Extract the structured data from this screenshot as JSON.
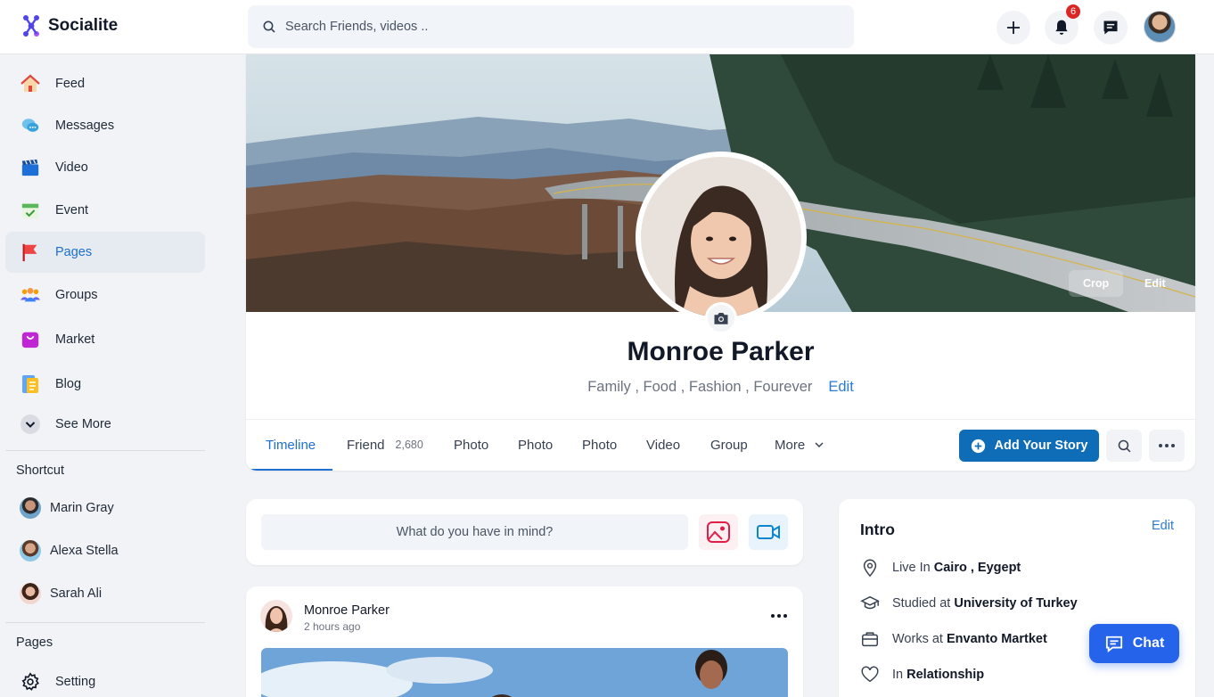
{
  "app": {
    "name": "Socialite"
  },
  "search": {
    "placeholder": "Search Friends, videos .."
  },
  "header": {
    "notification_count": "6"
  },
  "sidebar": {
    "items": [
      {
        "label": "Feed",
        "icon": "home-icon"
      },
      {
        "label": "Messages",
        "icon": "messages-icon"
      },
      {
        "label": "Video",
        "icon": "video-icon"
      },
      {
        "label": "Event",
        "icon": "event-icon"
      },
      {
        "label": "Pages",
        "icon": "flag-icon"
      },
      {
        "label": "Groups",
        "icon": "groups-icon"
      },
      {
        "label": "Market",
        "icon": "shopping-bag-icon"
      },
      {
        "label": "Blog",
        "icon": "blog-icon"
      },
      {
        "label": "See More",
        "icon": "chevron-down-icon"
      }
    ],
    "shortcut_title": "Shortcut",
    "shortcuts": [
      {
        "name": "Marin Gray"
      },
      {
        "name": "Alexa Stella"
      },
      {
        "name": "Sarah Ali"
      }
    ],
    "pages_title": "Pages",
    "setting_label": "Setting"
  },
  "profile": {
    "name": "Monroe Parker",
    "tags": "Family , Food , Fashion , Fourever",
    "edit_label": "Edit",
    "crop_label": "Crop",
    "cover_edit_label": "Edit",
    "tabs": [
      {
        "label": "Timeline"
      },
      {
        "label": "Friend",
        "count": "2,680"
      },
      {
        "label": "Photo"
      },
      {
        "label": "Photo"
      },
      {
        "label": "Photo"
      },
      {
        "label": "Video"
      },
      {
        "label": "Group"
      },
      {
        "label": "More"
      }
    ],
    "add_story_label": "Add Your Story"
  },
  "composer": {
    "placeholder": "What do you have in mind?"
  },
  "post": {
    "author": "Monroe Parker",
    "time": "2 hours ago"
  },
  "intro": {
    "title": "Intro",
    "edit_label": "Edit",
    "rows": [
      {
        "prefix": "Live In",
        "value": "Cairo , Eygept",
        "icon": "location-pin-icon"
      },
      {
        "prefix": "Studied at",
        "value": "University of Turkey",
        "icon": "graduation-cap-icon"
      },
      {
        "prefix": "Works at",
        "value": "Envanto Martket",
        "icon": "briefcase-icon"
      },
      {
        "prefix": "In",
        "value": "Relationship",
        "icon": "heart-icon"
      }
    ]
  },
  "chat": {
    "label": "Chat"
  },
  "colors": {
    "primary": "#0f6cb6",
    "accent": "#1e6fd1",
    "badge": "#dc2626",
    "chat": "#2563eb"
  }
}
